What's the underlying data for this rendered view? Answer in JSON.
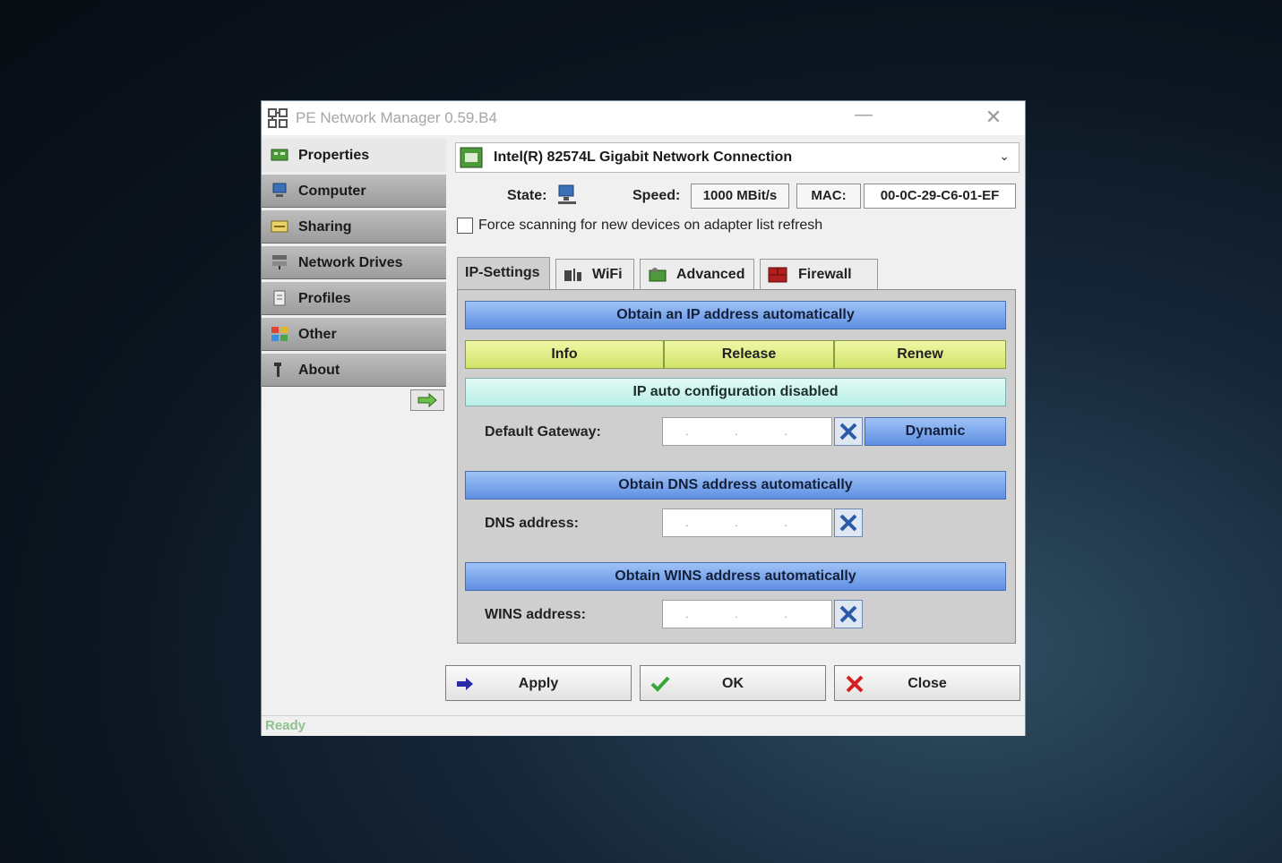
{
  "window": {
    "title": "PE Network Manager 0.59.B4",
    "minimize_glyph": "—",
    "close_glyph": "✕"
  },
  "sidebar": {
    "items": [
      {
        "label": "Properties",
        "icon": "network-card-icon",
        "active": true
      },
      {
        "label": "Computer",
        "icon": "computer-icon",
        "active": false
      },
      {
        "label": "Sharing",
        "icon": "sharing-icon",
        "active": false
      },
      {
        "label": "Network Drives",
        "icon": "network-drives-icon",
        "active": false
      },
      {
        "label": "Profiles",
        "icon": "profiles-icon",
        "active": false
      },
      {
        "label": "Other",
        "icon": "other-icon",
        "active": false
      },
      {
        "label": "About",
        "icon": "about-icon",
        "active": false
      }
    ],
    "arrow_icon": "arrow-right-icon"
  },
  "adapter": {
    "selected": "Intel(R) 82574L Gigabit Network Connection"
  },
  "status_row": {
    "state_label": "State:",
    "speed_label": "Speed:",
    "speed_value": "1000 MBit/s",
    "mac_label": "MAC:",
    "mac_value": "00-0C-29-C6-01-EF"
  },
  "force_scan": {
    "label": "Force scanning for new devices on adapter list refresh",
    "checked": false
  },
  "tabs": [
    {
      "label": "IP-Settings",
      "active": true
    },
    {
      "label": "WiFi",
      "icon": "wifi-icon",
      "active": false
    },
    {
      "label": "Advanced",
      "icon": "advanced-icon",
      "active": false
    },
    {
      "label": "Firewall",
      "icon": "firewall-icon",
      "active": false
    }
  ],
  "ip_settings": {
    "obtain_ip": "Obtain an IP address automatically",
    "info": "Info",
    "release": "Release",
    "renew": "Renew",
    "auto_config": "IP auto configuration disabled",
    "gateway_label": "Default Gateway:",
    "dynamic": "Dynamic",
    "obtain_dns": "Obtain DNS address automatically",
    "dns_label": "DNS address:",
    "obtain_wins": "Obtain WINS address automatically",
    "wins_label": "WINS address:",
    "ip_placeholder": ". . ."
  },
  "buttons": {
    "apply": "Apply",
    "ok": "OK",
    "close": "Close"
  },
  "status_bar": {
    "text": "Ready"
  },
  "colors": {
    "blue_bar": "#6f9de8",
    "yellow_button": "#dcea80",
    "cyan_bar": "#c8f4ec",
    "status_text": "#8fc28f"
  }
}
